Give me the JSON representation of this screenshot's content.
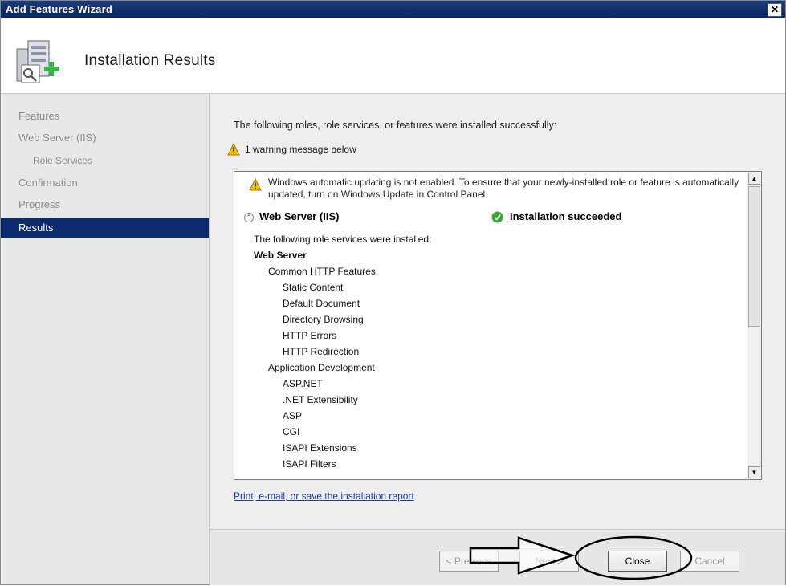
{
  "window": {
    "title": "Add Features Wizard",
    "close_glyph": "✕"
  },
  "header": {
    "title": "Installation Results",
    "icon": "server-install-icon"
  },
  "nav": {
    "items": [
      {
        "label": "Features",
        "sub": false,
        "active": false
      },
      {
        "label": "Web Server (IIS)",
        "sub": false,
        "active": false
      },
      {
        "label": "Role Services",
        "sub": true,
        "active": false
      },
      {
        "label": "Confirmation",
        "sub": false,
        "active": false
      },
      {
        "label": "Progress",
        "sub": false,
        "active": false
      },
      {
        "label": "Results",
        "sub": false,
        "active": true
      }
    ]
  },
  "content": {
    "intro": "The following roles, role services, or features were installed successfully:",
    "warning_summary": "1 warning message below",
    "results": {
      "warning_text": "Windows automatic updating is not enabled. To ensure that your newly-installed role or feature is automatically updated, turn on Windows Update in Control Panel.",
      "expander_glyph": "⌃",
      "role_name": "Web Server (IIS)",
      "status": "Installation succeeded",
      "installed_header": "The following role services were installed:",
      "services": [
        {
          "label": "Web Server",
          "level": 0,
          "bold": true
        },
        {
          "label": "Common HTTP Features",
          "level": 1
        },
        {
          "label": "Static Content",
          "level": 2
        },
        {
          "label": "Default Document",
          "level": 2
        },
        {
          "label": "Directory Browsing",
          "level": 2
        },
        {
          "label": "HTTP Errors",
          "level": 2
        },
        {
          "label": "HTTP Redirection",
          "level": 2
        },
        {
          "label": "Application Development",
          "level": 1
        },
        {
          "label": "ASP.NET",
          "level": 2
        },
        {
          "label": ".NET Extensibility",
          "level": 2
        },
        {
          "label": "ASP",
          "level": 2
        },
        {
          "label": "CGI",
          "level": 2
        },
        {
          "label": "ISAPI Extensions",
          "level": 2
        },
        {
          "label": "ISAPI Filters",
          "level": 2
        }
      ]
    },
    "report_link": "Print, e-mail, or save the installation report"
  },
  "footer": {
    "previous": "< Previous",
    "next": "Next >",
    "close": "Close",
    "cancel": "Cancel"
  },
  "colors": {
    "titlebar": "#0a2560",
    "nav_active": "#0b2b6e",
    "link": "#1a3aa8",
    "warning": "#f2c200",
    "success": "#3aa63a"
  }
}
